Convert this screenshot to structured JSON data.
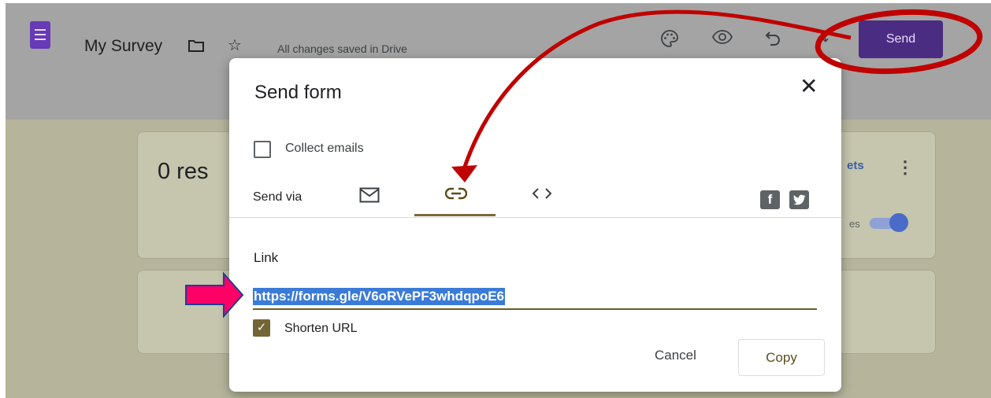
{
  "app": {
    "doc_title": "My Survey",
    "saved_status": "All changes saved in Drive",
    "send_label": "Send",
    "brand_color": "#673ab7",
    "icons": [
      "forms-logo-icon",
      "folder-icon",
      "star-icon",
      "palette-icon",
      "preview-eye-icon",
      "undo-icon",
      "redo-icon"
    ]
  },
  "background": {
    "responses_count": "0 res",
    "sheets_link": "ets",
    "accepting_label": "es"
  },
  "dialog": {
    "title": "Send form",
    "close_icon": "close-icon",
    "collect_emails_label": "Collect emails",
    "collect_emails_checked": false,
    "send_via_label": "Send via",
    "tabs": [
      {
        "name": "email",
        "icon": "mail-icon",
        "active": false
      },
      {
        "name": "link",
        "icon": "link-icon",
        "active": true
      },
      {
        "name": "embed",
        "icon": "code-icon",
        "active": false
      }
    ],
    "social": [
      "facebook-icon",
      "twitter-icon"
    ],
    "link_label": "Link",
    "link_url": "https://forms.gle/V6oRVePF3whdqpoE6",
    "shorten_url_label": "Shorten URL",
    "shorten_url_checked": true,
    "cancel_label": "Cancel",
    "copy_label": "Copy",
    "accent_color": "#736534"
  },
  "annotations": {
    "circle_color": "#c00000",
    "arrow_color": "#ff0066"
  }
}
